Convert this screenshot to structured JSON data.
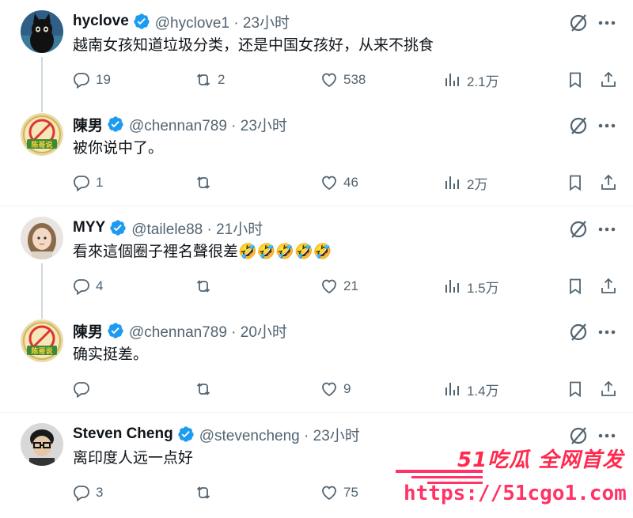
{
  "tweets": [
    {
      "name": "hyclove",
      "handle": "@hyclove1 · 23小时",
      "text": "越南女孩知道垃圾分类，还是中国女孩好，从来不挑食",
      "replies": "19",
      "retweets": "2",
      "likes": "538",
      "views": "2.1万",
      "avatar": "black-cat-avatar"
    },
    {
      "name": "陳男",
      "handle": "@chennan789 · 23小时",
      "text": "被你说中了。",
      "replies": "1",
      "retweets": "",
      "likes": "46",
      "views": "2万",
      "avatar": "badge-avatar",
      "badge_text": "陈哥说"
    },
    {
      "name": "MYY",
      "handle": "@tailele88 · 21小时",
      "text": "看來這個圈子裡名聲很差🤣🤣🤣🤣🤣",
      "replies": "4",
      "retweets": "",
      "likes": "21",
      "views": "1.5万",
      "avatar": "girl-avatar"
    },
    {
      "name": "陳男",
      "handle": "@chennan789 · 20小时",
      "text": "确实挺差。",
      "replies": "",
      "retweets": "",
      "likes": "9",
      "views": "1.4万",
      "avatar": "badge-avatar",
      "badge_text": "陈哥说"
    },
    {
      "name": "Steven Cheng",
      "handle": "@stevencheng · 23小时",
      "text": "离印度人远一点好",
      "replies": "3",
      "retweets": "",
      "likes": "75",
      "views": "",
      "avatar": "glasses-man-avatar"
    }
  ],
  "watermark": {
    "title": "51吃瓜 全网首发",
    "url": "https://51cgo1.com"
  },
  "colors": {
    "verified": "#1d9bf0",
    "muted": "#536471",
    "watermark": "#ff2a4e"
  }
}
